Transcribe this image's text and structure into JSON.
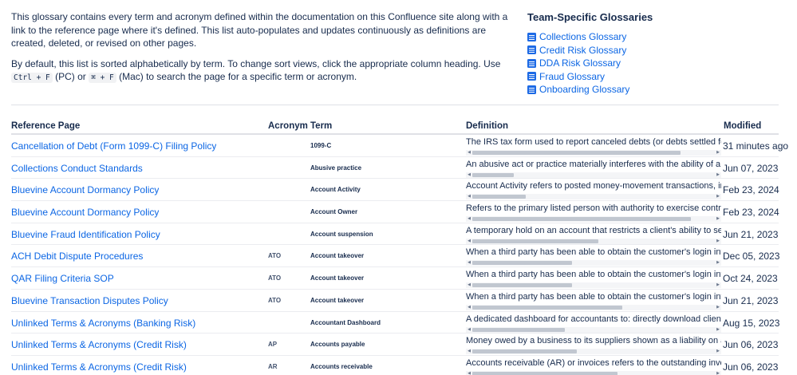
{
  "intro": {
    "p1": "This glossary contains every term and acronym defined within the documentation on this Confluence site along with a link to the reference page where it's defined. This list auto-populates and updates continuously as definitions are created, deleted, or revised on other pages.",
    "p2_part1": "By default, this list is sorted alphabetically by term. To change sort views, click the appropriate column heading. Use",
    "key_pc": "Ctrl + F",
    "p2_part2": "(PC) or",
    "key_mac": "⌘ + F",
    "p2_part3": "(Mac) to search the page for a specific term or acronym."
  },
  "team": {
    "title": "Team-Specific Glossaries",
    "links": [
      {
        "label": "Collections Glossary",
        "icon": "page-icon"
      },
      {
        "label": "Credit Risk Glossary",
        "icon": "page-icon"
      },
      {
        "label": "DDA Risk Glossary",
        "icon": "page-icon"
      },
      {
        "label": "Fraud Glossary",
        "icon": "page-icon"
      },
      {
        "label": "Onboarding Glossary",
        "icon": "page-icon"
      }
    ]
  },
  "table": {
    "headers": {
      "page": "Reference Page",
      "acronym": "Acronym",
      "term": "Term",
      "definition": "Definition",
      "modified": "Modified"
    },
    "rows": [
      {
        "page": "Cancellation of Debt (Form 1099-C) Filing Policy",
        "acronym": "",
        "term": "1099-C",
        "definition": "The IRS tax form used to report canceled debts (or debts settled for less than the full b",
        "modified": "31 minutes ago",
        "scroll": 0.86
      },
      {
        "page": "Collections Conduct Standards",
        "acronym": "",
        "term": "Abusive practice",
        "definition": "An abusive act or practice materially interferes with the ability of a client to understanc",
        "modified": "Jun 07, 2023",
        "scroll": 0.17
      },
      {
        "page": "Bluevine Account Dormancy Policy",
        "acronym": "",
        "term": "Account Activity",
        "definition": "Account Activity refers to posted money-movement transactions, including deposits, w",
        "modified": "Feb 23, 2024",
        "scroll": 0.22
      },
      {
        "page": "Bluevine Account Dormancy Policy",
        "acronym": "",
        "term": "Account Owner",
        "definition": "Refers to the primary listed person with authority to exercise control over the Bluevine",
        "modified": "Feb 23, 2024",
        "scroll": 0.9
      },
      {
        "page": "Bluevine Fraud Identification Policy",
        "acronym": "",
        "term": "Account suspension",
        "definition": "A temporary hold on an account that restricts a client's ability to send or receive funds",
        "modified": "Jun 21, 2023",
        "scroll": 0.52
      },
      {
        "page": "ACH Debit Dispute Procedures",
        "acronym": "ATO",
        "term": "Account takeover",
        "definition": "When a third party has been able to obtain the customer's login information and assu",
        "modified": "Dec 05, 2023",
        "scroll": 0.41
      },
      {
        "page": "QAR Filing Criteria SOP",
        "acronym": "ATO",
        "term": "Account takeover",
        "definition": "When a third party has been able to obtain the customer's login information and assu",
        "modified": "Oct 24, 2023",
        "scroll": 0.41
      },
      {
        "page": "Bluevine Transaction Disputes Policy",
        "acronym": "ATO",
        "term": "Account takeover",
        "definition": "When a third party has been able to obtain the customer's login information and assu",
        "modified": "Jun 21, 2023",
        "scroll": 0.62
      },
      {
        "page": "Unlinked Terms & Acronyms (Banking Risk)",
        "acronym": "",
        "term": "Accountant Dashboard",
        "definition": "A dedicated dashboard for accountants to: directly download clients' statements; add",
        "modified": "Aug 15, 2023",
        "scroll": 0.38
      },
      {
        "page": "Unlinked Terms & Acronyms (Credit Risk)",
        "acronym": "AP",
        "term": "Accounts payable",
        "definition": "Money owed by a business to its suppliers shown as a liability on a company's balance",
        "modified": "Jun 06, 2023",
        "scroll": 0.43
      },
      {
        "page": "Unlinked Terms & Acronyms (Credit Risk)",
        "acronym": "AR",
        "term": "Accounts receivable",
        "definition": "Accounts receivable (AR) or invoices refers to the outstanding invoices a company has",
        "modified": "Jun 06, 2023",
        "scroll": 0.6
      }
    ]
  }
}
